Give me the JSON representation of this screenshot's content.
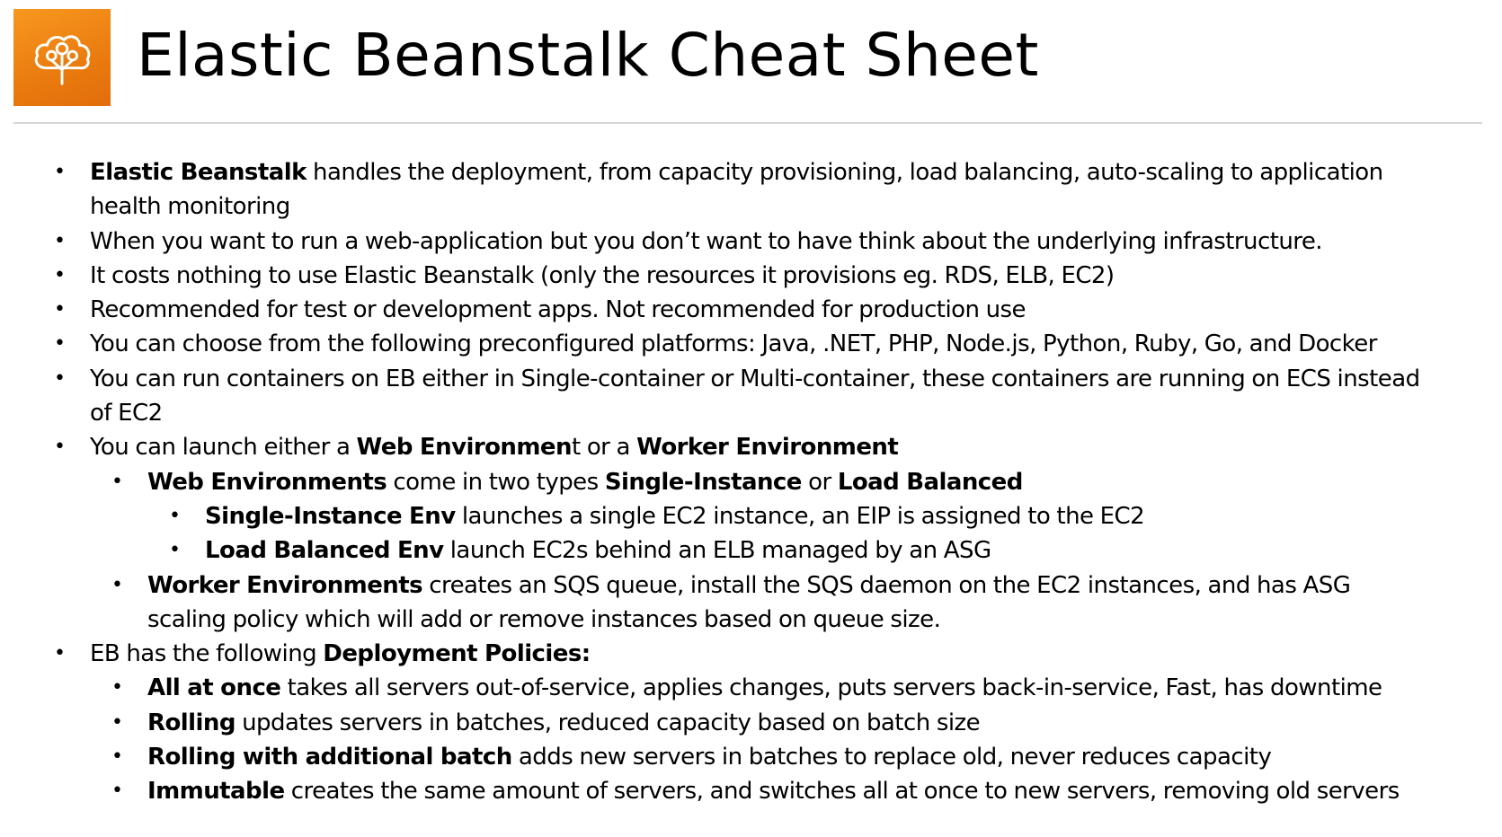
{
  "header": {
    "title": "Elastic Beanstalk Cheat Sheet",
    "logo_icon": "elastic-beanstalk-tree-cloud-icon",
    "logo_color": "#f0871a"
  },
  "bullets": [
    {
      "level": 1,
      "bold": "Elastic Beanstalk",
      "rest": " handles the deployment, from capacity provisioning, load balancing, auto-scaling to application health monitoring"
    },
    {
      "level": 1,
      "before": "When you want to run a web-application but you don’t want to have think about the underlying infrastructure."
    },
    {
      "level": 1,
      "before": "It costs nothing to use Elastic Beanstalk (only the resources it provisions eg. RDS, ELB, EC2)"
    },
    {
      "level": 1,
      "before": "Recommended for test or development apps. Not recommended for production use"
    },
    {
      "level": 1,
      "before": "You can choose from the following preconfigured platforms: Java, .NET, PHP, Node.js, Python, Ruby, Go, and Docker"
    },
    {
      "level": 1,
      "before": "You can run containers on EB either in Single-container or Multi-container, these containers are running on ECS instead of EC2"
    },
    {
      "level": 1,
      "before": "You can launch either a ",
      "bold": "Web Environmen",
      "mid": "t or a ",
      "bold2": "Worker Environment"
    },
    {
      "level": 2,
      "bold": "Web Environments",
      "mid": " come in two types ",
      "bold2": "Single-Instance",
      "mid2": " or ",
      "bold3": "Load Balanced"
    },
    {
      "level": 3,
      "bold": "Single-Instance Env",
      "rest": " launches a single EC2 instance, an EIP is assigned to the EC2"
    },
    {
      "level": 3,
      "bold": "Load Balanced Env",
      "rest": " launch EC2s behind an ELB managed by an ASG"
    },
    {
      "level": 2,
      "bold": "Worker Environments",
      "rest": " creates an SQS queue, install the SQS daemon on the EC2 instances, and has ASG scaling policy which will add or remove instances based on queue size."
    },
    {
      "level": 1,
      "before": "EB has the following ",
      "bold": "Deployment Policies:"
    },
    {
      "level": 2,
      "bold": "All at once",
      "rest": " takes all servers out-of-service, applies changes, puts servers back-in-service, Fast, has downtime"
    },
    {
      "level": 2,
      "bold": "Rolling",
      "rest": " updates servers in batches, reduced capacity based on batch size"
    },
    {
      "level": 2,
      "bold": "Rolling with additional batch",
      "rest": "  adds new servers in batches to replace old, never reduces capacity"
    },
    {
      "level": 2,
      "bold": "Immutable",
      "rest": " creates the same amount of servers, and switches all at once to new servers, removing old servers"
    }
  ]
}
